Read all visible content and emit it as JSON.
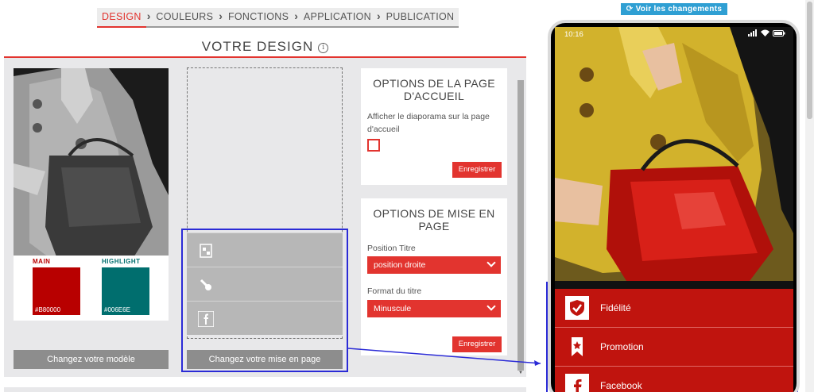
{
  "breadcrumb": [
    "DESIGN",
    "COULEURS",
    "FONCTIONS",
    "APPLICATION",
    "PUBLICATION"
  ],
  "breadcrumb_separator": "›",
  "section_title": "VOTRE DESIGN",
  "info_glyph": "i",
  "template": {
    "main_label": "MAIN",
    "highlight_label": "HIGHLIGHT",
    "main_color": "#B80000",
    "highlight_color": "#006E6E",
    "change_template_button": "Changez votre modèle"
  },
  "layout": {
    "change_layout_button": "Changez votre mise en page",
    "slot_icons": [
      "card-icon",
      "promotion-icon",
      "facebook-icon"
    ]
  },
  "home_options": {
    "title": "OPTIONS DE LA PAGE D'ACCUEIL",
    "slideshow_text": "Afficher le diaporama sur la page d'accueil",
    "slideshow_checked": false,
    "save_button": "Enregistrer"
  },
  "layout_options": {
    "title": "OPTIONS DE MISE EN PAGE",
    "position_label": "Position Titre",
    "position_value": "position droite",
    "format_label": "Format du titre",
    "format_value": "Minuscule",
    "save_button": "Enregistrer"
  },
  "preview": {
    "button": "Voir les changements",
    "status_time": "10:16",
    "menu": [
      {
        "label": "Fidélité",
        "icon": "shield-check-icon"
      },
      {
        "label": "Promotion",
        "icon": "ribbon-star-icon"
      },
      {
        "label": "Facebook",
        "icon": "facebook-icon"
      }
    ]
  },
  "colors": {
    "accent": "#e2342f",
    "highlight_box": "#2b2bd6",
    "menu_bg": "#c0140e",
    "preview_button": "#2f9fd3"
  }
}
